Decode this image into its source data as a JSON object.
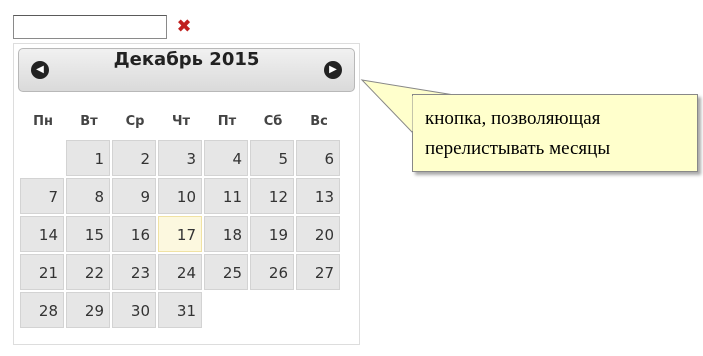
{
  "input": {
    "value": ""
  },
  "clear_icon": "close-x-icon",
  "calendar": {
    "title": "Декабрь 2015",
    "prev_icon": "chevron-left-icon",
    "next_icon": "chevron-right-icon",
    "weekdays": [
      "Пн",
      "Вт",
      "Ср",
      "Чт",
      "Пт",
      "Сб",
      "Вс"
    ],
    "weeks": [
      [
        "",
        "1",
        "2",
        "3",
        "4",
        "5",
        "6"
      ],
      [
        "7",
        "8",
        "9",
        "10",
        "11",
        "12",
        "13"
      ],
      [
        "14",
        "15",
        "16",
        "17",
        "18",
        "19",
        "20"
      ],
      [
        "21",
        "22",
        "23",
        "24",
        "25",
        "26",
        "27"
      ],
      [
        "28",
        "29",
        "30",
        "31",
        "",
        "",
        ""
      ]
    ],
    "highlighted_day": "17"
  },
  "callout": {
    "line1": "кнопка, позволяющая",
    "line2": "перелистывать месяцы"
  },
  "colors": {
    "clear": "#c0201f",
    "today_bg": "#fcf8df",
    "callout_bg": "#ffffcc"
  }
}
